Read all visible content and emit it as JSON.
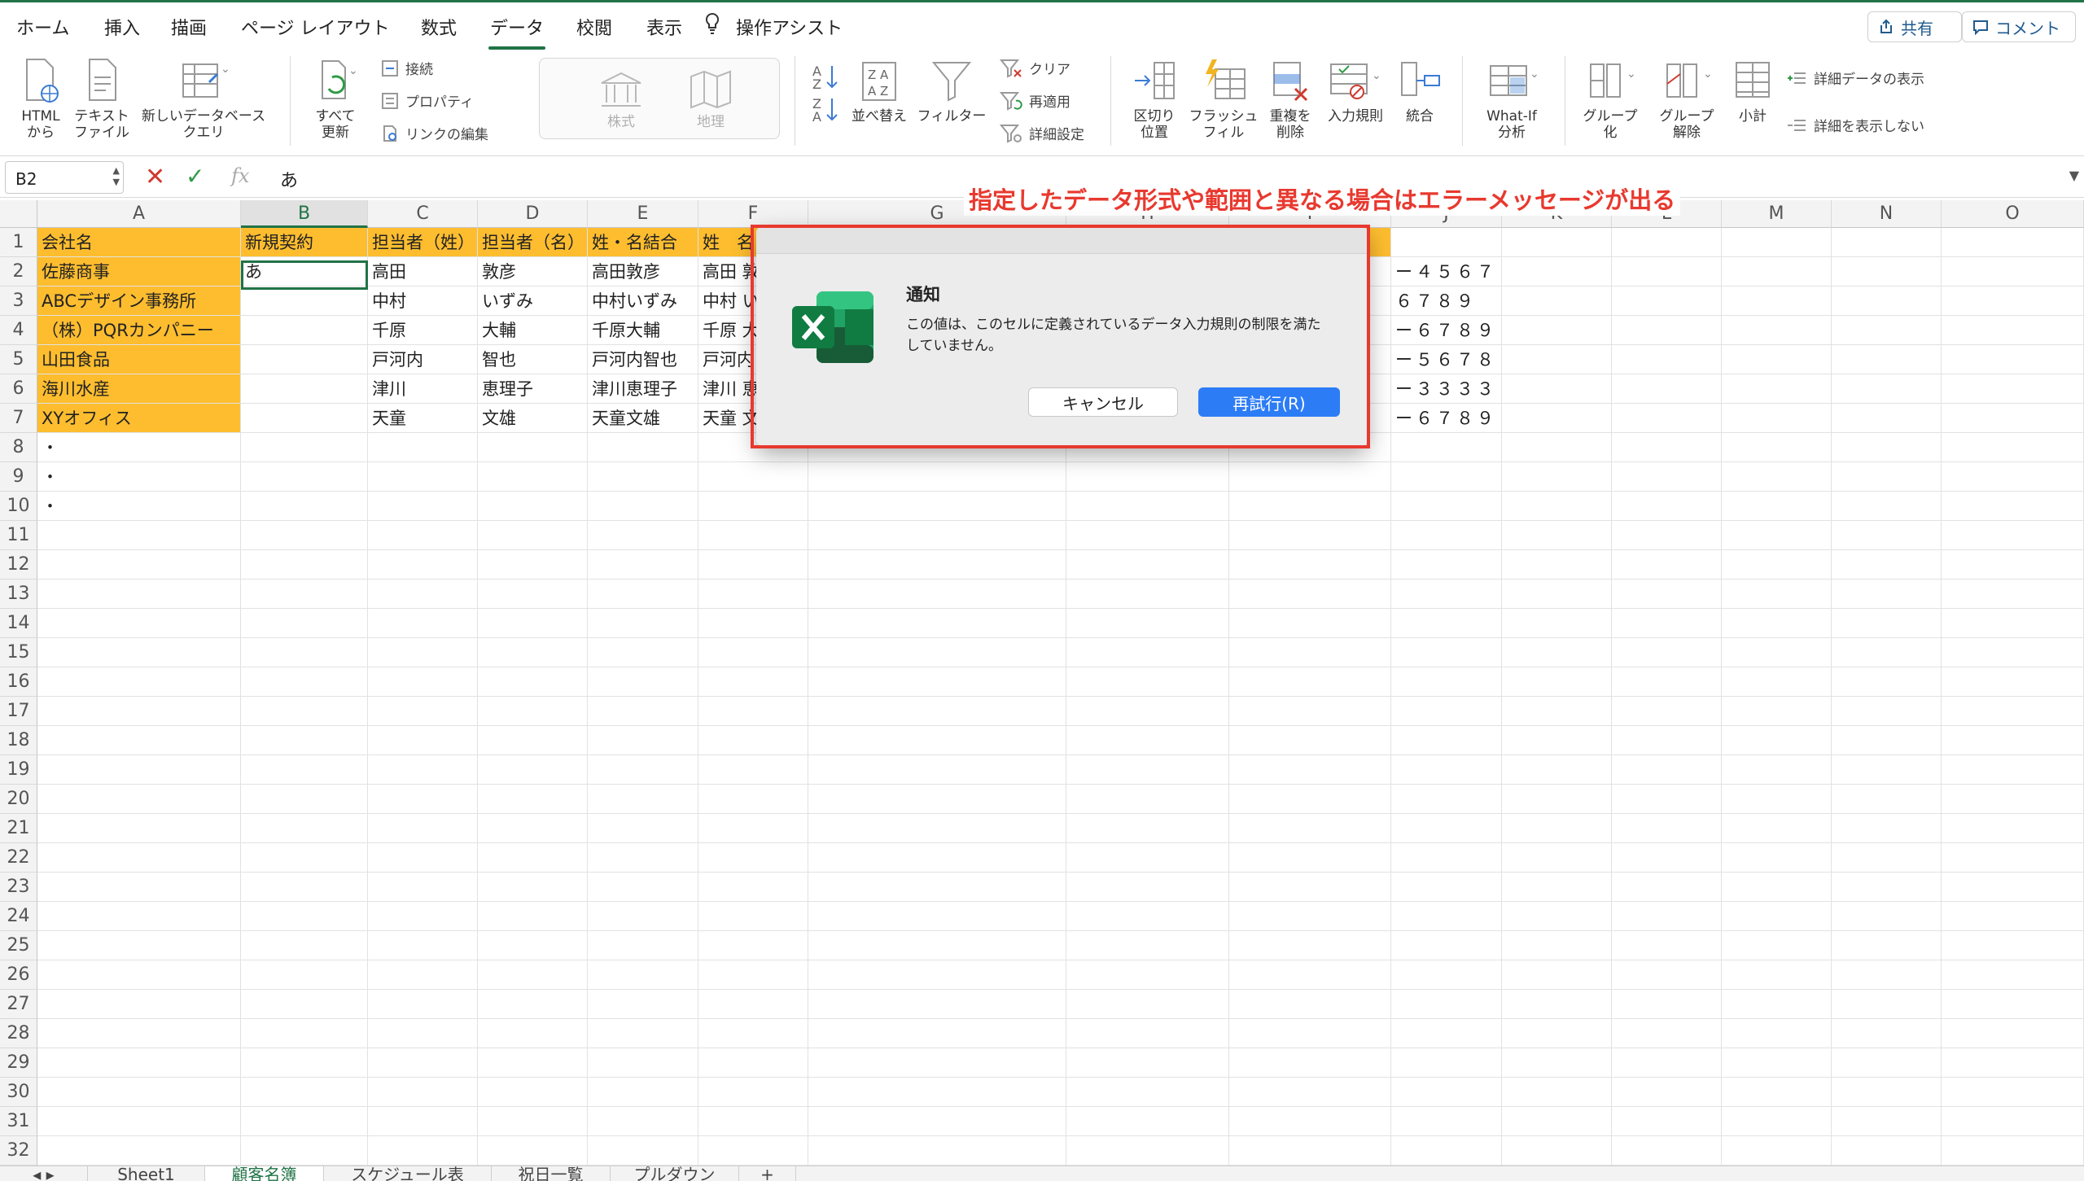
{
  "menu": {
    "tabs": [
      "ホーム",
      "挿入",
      "描画",
      "ページ レイアウト",
      "数式",
      "データ",
      "校閲",
      "表示",
      "操作アシスト"
    ],
    "share_label": "共有",
    "comment_label": "コメント"
  },
  "ribbon": {
    "html_from": "HTML\nから",
    "text_file": "テキスト\nファイル",
    "new_query": "新しいデータベース\nクエリ",
    "refresh_all": "すべて\n更新",
    "connections": "接続",
    "properties": "プロパティ",
    "edit_links": "リンクの編集",
    "stocks": "株式",
    "geography": "地理",
    "sort": "並べ替え",
    "filter": "フィルター",
    "clear": "クリア",
    "reapply": "再適用",
    "advanced": "詳細設定",
    "text_to_columns": "区切り\n位置",
    "flash_fill": "フラッシュ\nフィル",
    "remove_duplicates": "重複を\n削除",
    "data_validation": "入力規則",
    "consolidate": "統合",
    "what_if": "What-If\n分析",
    "group": "グループ\n化",
    "ungroup": "グループ\n解除",
    "subtotal": "小計",
    "show_detail": "詳細データの表示",
    "hide_detail": "詳細を表示しない"
  },
  "formula_bar": {
    "cell_ref": "B2",
    "value": "あ",
    "fx": "fx"
  },
  "columns": [
    "A",
    "B",
    "C",
    "D",
    "E",
    "F",
    "G",
    "H",
    "I",
    "J",
    "K",
    "L",
    "M",
    "N",
    "O"
  ],
  "rows": [
    "1",
    "2",
    "3",
    "4",
    "5",
    "6",
    "7",
    "8",
    "9",
    "10",
    "11",
    "12",
    "13",
    "14",
    "15",
    "16",
    "17",
    "18",
    "19",
    "20",
    "21",
    "22",
    "23",
    "24",
    "25",
    "26",
    "27",
    "28",
    "29",
    "30",
    "31",
    "32"
  ],
  "sheet": {
    "header": [
      "会社名",
      "新規契約",
      "担当者（姓）",
      "担当者（名）",
      "姓・名結合",
      "姓　名"
    ],
    "data": [
      [
        "佐藤商事",
        "あ",
        "高田",
        "敦彦",
        "高田敦彦",
        "高田 敦",
        "ー４５６７"
      ],
      [
        "ABCデザイン事務所",
        "",
        "中村",
        "いずみ",
        "中村いずみ",
        "中村 い",
        "６７８９"
      ],
      [
        "（株）PQRカンパニー",
        "",
        "千原",
        "大輔",
        "千原大輔",
        "千原 大",
        "ー６７８９"
      ],
      [
        "山田食品",
        "",
        "戸河内",
        "智也",
        "戸河内智也",
        "戸河内",
        "ー５６７８"
      ],
      [
        "海川水産",
        "",
        "津川",
        "恵理子",
        "津川恵理子",
        "津川 恵",
        "ー３３３３"
      ],
      [
        "XYオフィス",
        "",
        "天童",
        "文雄",
        "天童文雄",
        "天童 文",
        "ー６７８９"
      ]
    ],
    "dots": [
      "・",
      "・",
      "・"
    ]
  },
  "dialog": {
    "title": "通知",
    "message": "この値は、このセルに定義されているデータ入力規則の制限を満たしていません。",
    "cancel": "キャンセル",
    "retry": "再試行(R)"
  },
  "annotation": "指定したデータ形式や範囲と異なる場合はエラーメッセージが出る",
  "sheet_tabs": [
    "Sheet1",
    "顧客名簿",
    "スケジュール表",
    "祝日一覧",
    "プルダウン",
    "+"
  ],
  "colors": {
    "accent": "#217346",
    "highlight": "#fdbd2f",
    "alert_red": "#e8392f",
    "button_blue": "#2c7cf6"
  }
}
